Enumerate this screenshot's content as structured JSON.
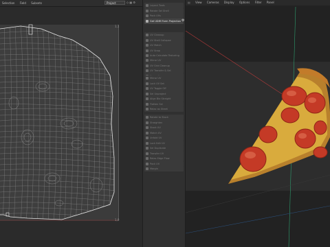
{
  "uv_editor": {
    "menu": [
      "Selection",
      "Field",
      "Subsets"
    ],
    "project_dropdown": "Project",
    "corner_labels": {
      "top_left": "0,1",
      "top_right": "1,1",
      "bottom_left": "0,0",
      "bottom_right": "1,0"
    }
  },
  "tool_panel": {
    "items": [
      {
        "label": "Layout Tools",
        "active": false
      },
      {
        "label": "Rotate Sel Shell",
        "active": false
      },
      {
        "label": "Pack UVs",
        "active": false
      },
      {
        "label": "Get UDIM Form Projection",
        "active": true
      },
      {
        "label": "UV Cleanup",
        "active": false
      },
      {
        "label": "UV Shell Collapse",
        "active": false
      },
      {
        "label": "UV Match",
        "active": false
      },
      {
        "label": "UV Snap",
        "active": false
      },
      {
        "label": "Auto Calculate Texturing",
        "active": false
      },
      {
        "label": "Pack Attachment Data",
        "active": false
      },
      {
        "label": "Mirror UV",
        "active": false
      },
      {
        "label": "UV Grid Cleanup",
        "active": false
      },
      {
        "label": "UV Transfer & Sel",
        "active": false
      },
      {
        "label": "Normalize",
        "active": false
      },
      {
        "label": "Mirror UV",
        "active": false
      },
      {
        "label": "Lock UV Set",
        "active": false
      },
      {
        "label": "UV Toggle Off",
        "active": false
      },
      {
        "label": "Sel Unproject",
        "active": false
      },
      {
        "label": "Align Bio Straight",
        "active": false
      },
      {
        "label": "Flatten Sel",
        "active": false
      },
      {
        "label": "Relax as Sheet",
        "active": false
      },
      {
        "label": "Rotate to Stack",
        "active": false
      },
      {
        "label": "Straighten",
        "active": false
      },
      {
        "label": "Stack UV",
        "active": false
      },
      {
        "label": "Match UV",
        "active": false
      },
      {
        "label": "Unfold UV",
        "active": false
      },
      {
        "label": "Lock Edit UV",
        "active": false
      },
      {
        "label": "Sel Duplicate",
        "active": false
      },
      {
        "label": "Transfer UV",
        "active": false
      },
      {
        "label": "Relax Edge Flow",
        "active": false
      },
      {
        "label": "Pack UV",
        "active": false
      },
      {
        "label": "Margin",
        "active": false
      }
    ]
  },
  "viewport": {
    "menu": [
      "View",
      "Cameras",
      "Display",
      "Options",
      "Filter",
      "Panel"
    ]
  },
  "colors": {
    "pepperoni": "#c43a26",
    "crust": "#c88b2a",
    "cheese": "#e0b84a",
    "guide_red": "#c0392b",
    "guide_green": "#2e9e6e",
    "guide_blue": "#2b6cb0"
  }
}
